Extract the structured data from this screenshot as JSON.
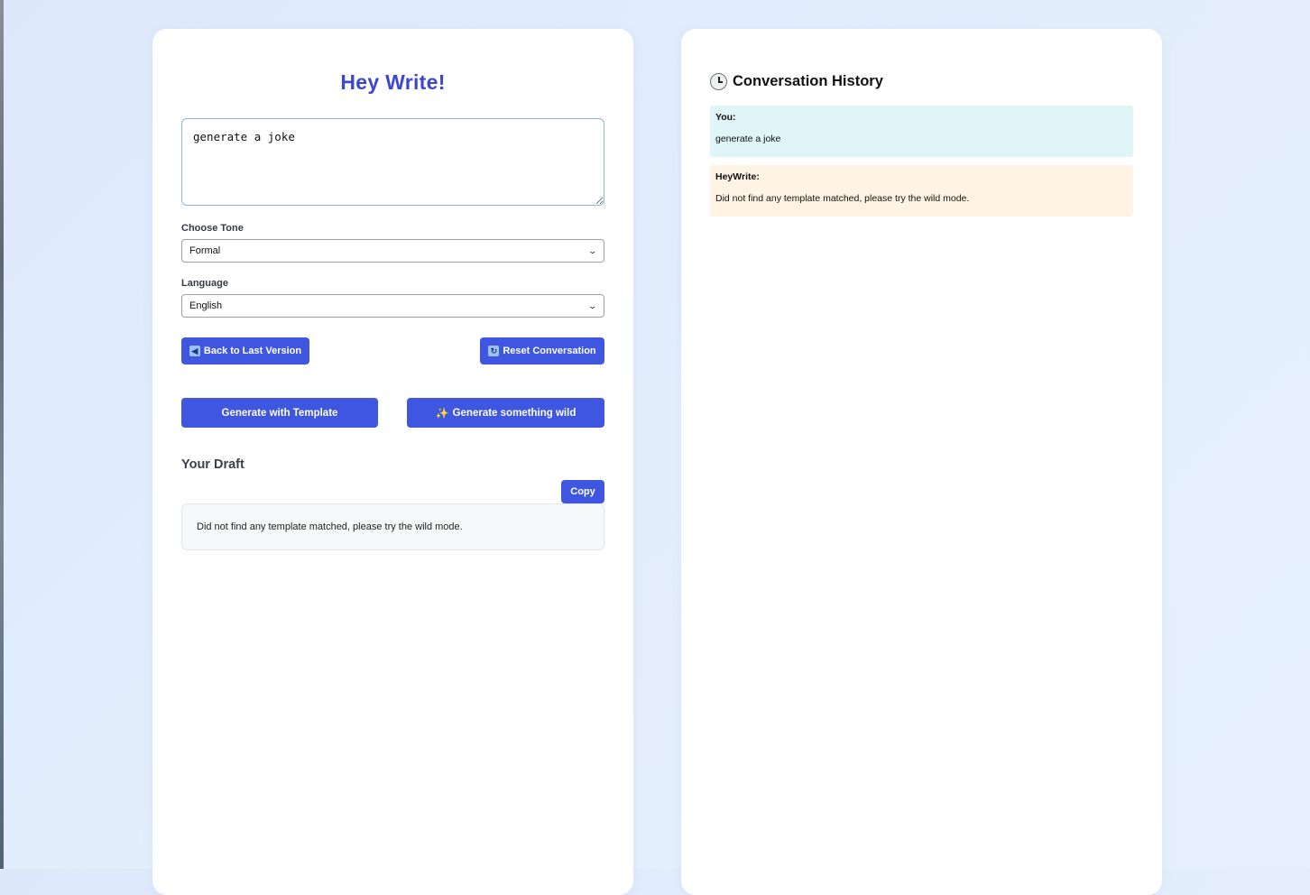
{
  "app": {
    "title": "Hey Write!"
  },
  "prompt": {
    "value": "generate a joke"
  },
  "tone": {
    "label": "Choose Tone",
    "selected": "Formal"
  },
  "language": {
    "label": "Language",
    "selected": "English"
  },
  "actions": {
    "back_label": "Back to Last Version",
    "back_icon": "back-arrow-icon",
    "reset_label": "Reset Conversation",
    "reset_icon": "refresh-icon",
    "generate_template_label": "Generate with Template",
    "generate_wild_label": "Generate something wild",
    "generate_wild_icon": "sparkles-icon"
  },
  "draft": {
    "heading": "Your Draft",
    "copy_label": "Copy",
    "text": "Did not find any template matched, please try the wild mode."
  },
  "history": {
    "title": "Conversation History",
    "title_icon": "clock-icon",
    "messages": [
      {
        "sender": "You:",
        "text": "generate a joke"
      },
      {
        "sender": "HeyWrite:",
        "text": "Did not find any template matched, please try the wild mode."
      }
    ]
  },
  "colors": {
    "accent": "#3f56e0",
    "title": "#3b46d4",
    "user_bubble": "#dff5f8",
    "bot_bubble": "#fff3e3",
    "background": "#e0ecfc"
  }
}
